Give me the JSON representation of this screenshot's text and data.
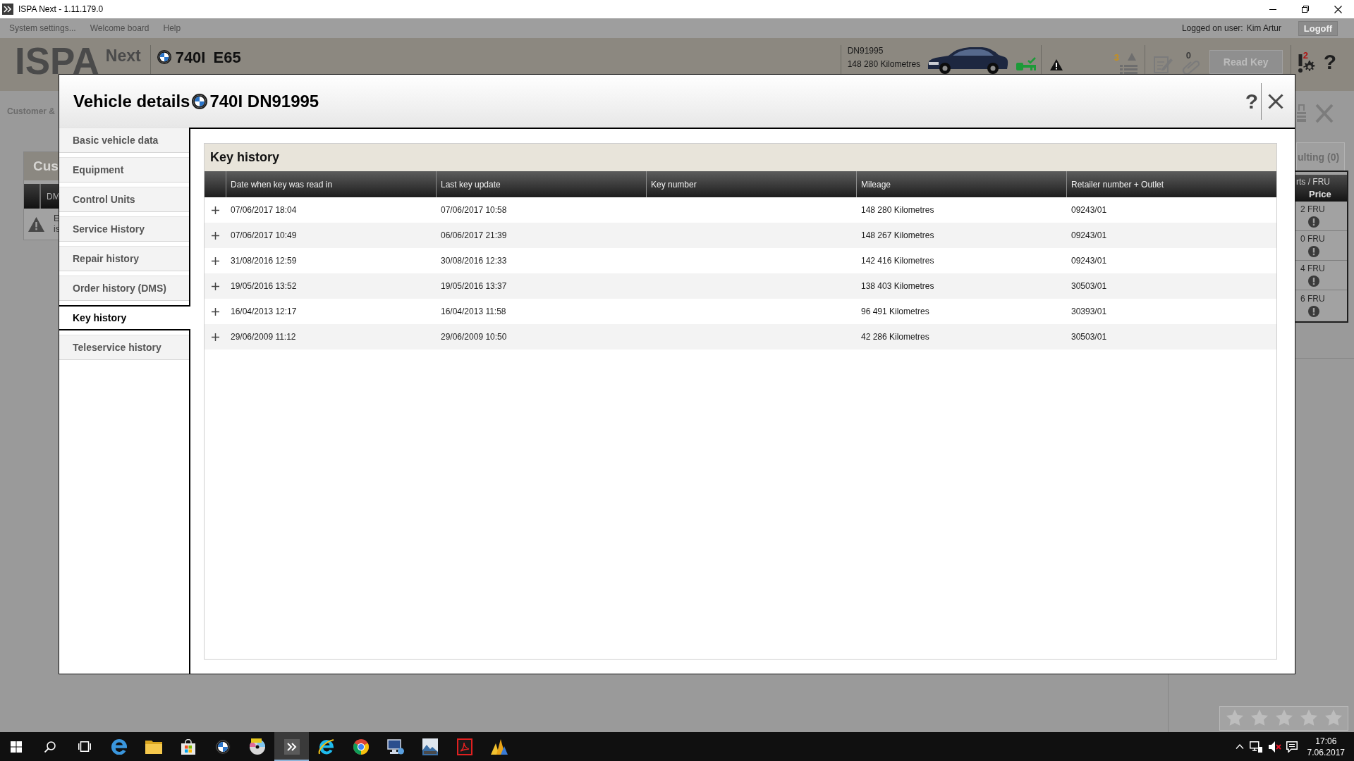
{
  "window": {
    "title": "ISPA Next - 1.11.179.0"
  },
  "menu_bar": {
    "items": [
      "System settings...",
      "Welcome board",
      "Help"
    ],
    "user_label": "Logged on user:",
    "user_name": "Kim Artur",
    "logoff": {
      "label": "Logoff",
      "disabled": true
    }
  },
  "header": {
    "logo": "ISPA",
    "logo_suffix": "Next",
    "model": "740I",
    "series": "E65",
    "plate": "DN91995",
    "mileage": "148 280 Kilometres",
    "list_count": "3",
    "attachment_count": "0",
    "read_key": {
      "label": "Read Key",
      "disabled": true
    },
    "settings_badge": "2",
    "help": "?"
  },
  "workspace": {
    "customer_tab": "Customer &",
    "customer_panel": {
      "title": "Cus",
      "column": "DM",
      "message": [
        "E",
        "is"
      ]
    },
    "consulting_tab": "ulting (0)",
    "parts_table": {
      "header": [
        "rts / FRU",
        "Price"
      ],
      "rows": [
        "2 FRU",
        "0 FRU",
        "4 FRU",
        "6 FRU"
      ]
    },
    "rating": {
      "stars": 0
    }
  },
  "dialog": {
    "title": "Vehicle details",
    "vehicle": "740I DN91995",
    "help": "?",
    "nav": [
      {
        "label": "Basic vehicle data",
        "selected": false
      },
      {
        "label": "Equipment",
        "selected": false
      },
      {
        "label": "Control Units",
        "selected": false
      },
      {
        "label": "Service History",
        "selected": false
      },
      {
        "label": "Repair history",
        "selected": false
      },
      {
        "label": "Order history (DMS)",
        "selected": false
      },
      {
        "label": "Key history",
        "selected": true
      },
      {
        "label": "Teleservice history",
        "selected": false
      }
    ],
    "panel": {
      "title": "Key history",
      "columns": [
        "Date when key was read in",
        "Last key update",
        "Key number",
        "Mileage",
        "Retailer number + Outlet"
      ],
      "rows": [
        {
          "expanded": false,
          "read_in": "07/06/2017 18:04",
          "last_update": "07/06/2017 10:58",
          "mileage": "148 280 Kilometres",
          "retailer": "09243/01"
        },
        {
          "expanded": false,
          "read_in": "07/06/2017 10:49",
          "last_update": "06/06/2017 21:39",
          "mileage": "148 267 Kilometres",
          "retailer": "09243/01"
        },
        {
          "expanded": false,
          "read_in": "31/08/2016 12:59",
          "last_update": "30/08/2016 12:33",
          "mileage": "142 416 Kilometres",
          "retailer": "09243/01"
        },
        {
          "expanded": false,
          "read_in": "19/05/2016 13:52",
          "last_update": "19/05/2016 13:37",
          "mileage": "138 403 Kilometres",
          "retailer": "30503/01"
        },
        {
          "expanded": false,
          "read_in": "16/04/2013 12:17",
          "last_update": "16/04/2013 11:58",
          "mileage": "96 491 Kilometres",
          "retailer": "30393/01"
        },
        {
          "expanded": false,
          "read_in": "29/06/2009 11:12",
          "last_update": "29/06/2009 10:50",
          "mileage": "42 286 Kilometres",
          "retailer": "30503/01"
        }
      ]
    }
  },
  "taskbar": {
    "apps": [
      {
        "kind": "edge",
        "selected": false
      },
      {
        "kind": "folder",
        "selected": false
      },
      {
        "kind": "store",
        "selected": false
      },
      {
        "kind": "globe",
        "selected": false
      },
      {
        "kind": "disc",
        "selected": false
      },
      {
        "kind": "chevrons",
        "selected": true
      },
      {
        "kind": "ie",
        "selected": false
      },
      {
        "kind": "chrome",
        "selected": false
      },
      {
        "kind": "monitor",
        "selected": false
      },
      {
        "kind": "picture",
        "selected": false
      },
      {
        "kind": "pdf",
        "selected": false
      },
      {
        "kind": "chart",
        "selected": false
      }
    ],
    "clock": {
      "time": "17:06",
      "date": "7.06.2017"
    }
  }
}
